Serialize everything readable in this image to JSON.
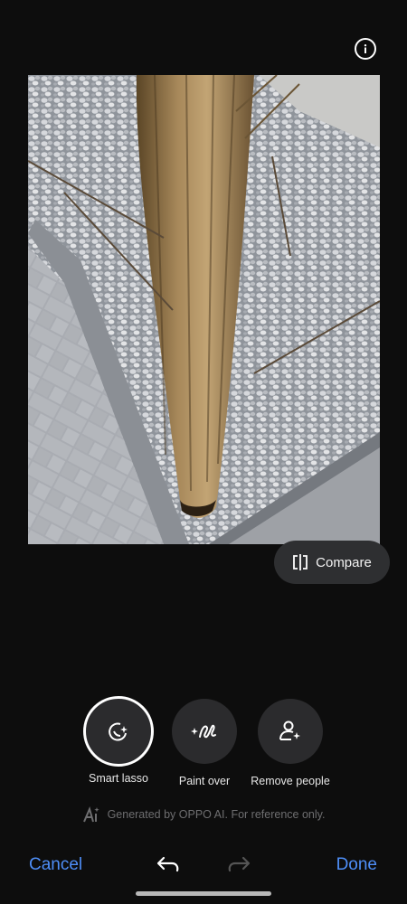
{
  "header": {
    "info_icon": "info-icon"
  },
  "photo": {
    "subject": "dried ornamental grass on gravel bed"
  },
  "compare": {
    "label": "Compare",
    "icon": "compare-icon"
  },
  "tools": [
    {
      "label": "Smart lasso",
      "icon": "smart-lasso-icon",
      "active": true
    },
    {
      "label": "Paint over",
      "icon": "paint-over-icon",
      "active": false
    },
    {
      "label": "Remove people",
      "icon": "remove-people-icon",
      "active": false
    }
  ],
  "ai_note": {
    "text": "Generated by OPPO AI. For reference only.",
    "icon": "ai-icon"
  },
  "footer": {
    "cancel_label": "Cancel",
    "done_label": "Done",
    "undo_icon": "undo-icon",
    "redo_icon": "redo-icon"
  },
  "colors": {
    "accent": "#4e8ef7",
    "background": "#0d0d0d",
    "button_bg": "#2b2b2d"
  }
}
